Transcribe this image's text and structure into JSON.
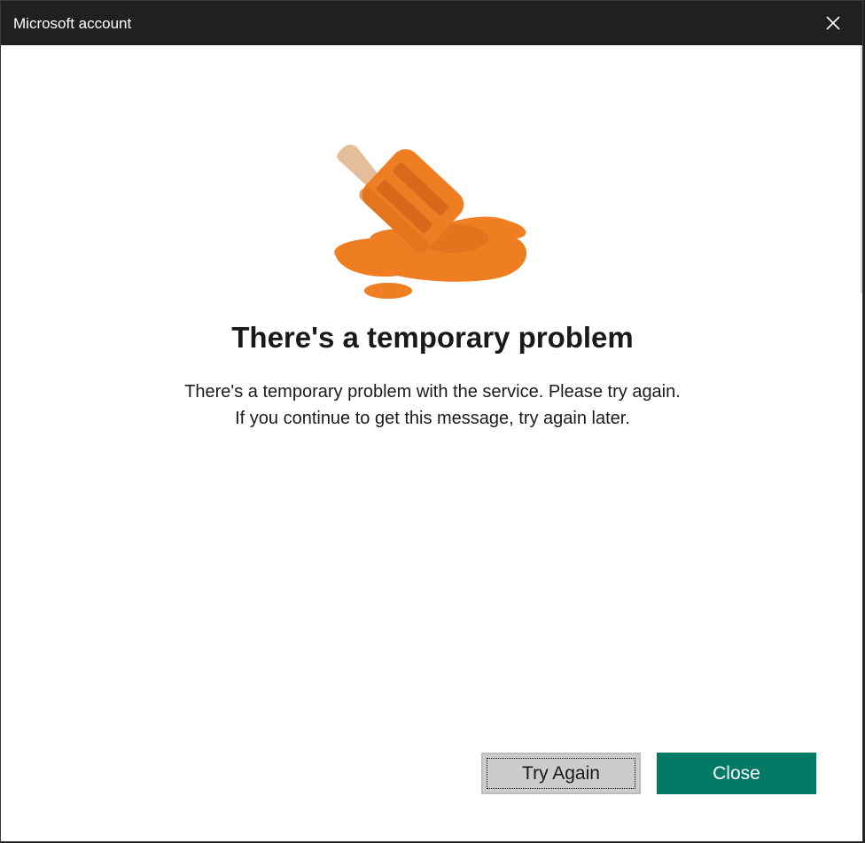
{
  "window": {
    "title": "Microsoft account"
  },
  "dialog": {
    "heading": "There's a temporary problem",
    "message": "There's a temporary problem with the service. Please try again. If you continue to get this message, try again later.",
    "illustration_icon": "melted-popsicle-icon"
  },
  "buttons": {
    "try_again_label": "Try Again",
    "close_label": "Close"
  },
  "colors": {
    "titlebar": "#202020",
    "accent": "#007a64",
    "illustration_orange": "#ef7d22",
    "illustration_stick": "#e4bd9b"
  }
}
